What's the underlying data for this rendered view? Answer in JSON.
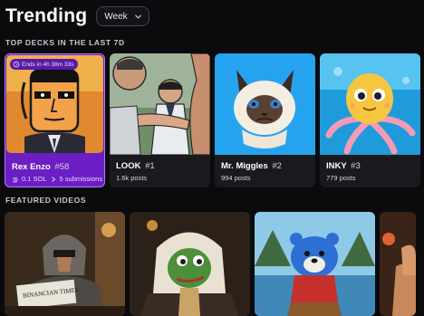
{
  "header": {
    "title": "Trending",
    "period": {
      "selected": "Week"
    }
  },
  "sections": {
    "top_decks": "TOP DECKS IN THE LAST 7D",
    "featured": "FEATURED VIDEOS"
  },
  "decks": [
    {
      "name": "Rex Enzo",
      "rank": "#58",
      "timer": "Ends in 4h 38m 33s",
      "amount": "0.1 SOL",
      "submissions": "5 submissions"
    },
    {
      "name": "LOOK",
      "rank": "#1",
      "posts": "1.6k posts"
    },
    {
      "name": "Mr. Miggles",
      "rank": "#2",
      "posts": "994 posts"
    },
    {
      "name": "INKY",
      "rank": "#3",
      "posts": "779 posts"
    }
  ],
  "videos": [
    {
      "caption_text": "BINANCIAN TIMES"
    },
    {},
    {},
    {}
  ],
  "colors": {
    "active_deck": "#6b1ec4",
    "background": "#0b0b0d"
  }
}
